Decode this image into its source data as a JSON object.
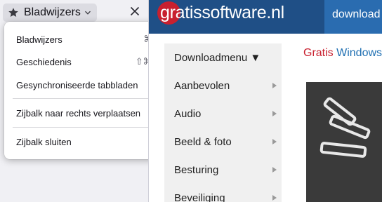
{
  "sidebar": {
    "switcher_label": "Bladwijzers",
    "menu": {
      "items": [
        {
          "label": "Bladwijzers",
          "shortcut": "⌘B"
        },
        {
          "label": "Geschiedenis",
          "shortcut": "⇧⌘H"
        },
        {
          "label": "Gesynchroniseerde tabbladen",
          "shortcut": ""
        },
        {
          "label": "Zijbalk naar rechts verplaatsen",
          "shortcut": ""
        },
        {
          "label": "Zijbalk sluiten",
          "shortcut": ""
        }
      ]
    }
  },
  "web": {
    "logo_text": "gratissoftware.nl",
    "header_tab": "download",
    "nav": [
      {
        "label": "Downloadmenu ▼"
      },
      {
        "label": "Aanbevolen"
      },
      {
        "label": "Audio"
      },
      {
        "label": "Beeld & foto"
      },
      {
        "label": "Besturing"
      },
      {
        "label": "Beveiliging"
      }
    ],
    "title_part1": "Gratis",
    "title_part2": "Windows"
  },
  "colors": {
    "site_header": "#1f4f86",
    "logo_red": "#c8202f",
    "link_blue": "#1f6fb2"
  }
}
